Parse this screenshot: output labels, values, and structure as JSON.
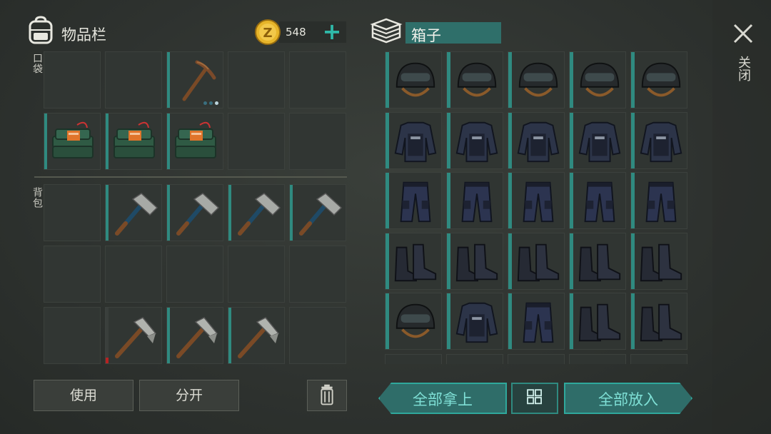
{
  "header": {
    "inventory_title": "物品栏",
    "coin_count": "548",
    "plus_symbol": "+",
    "box_title": "箱子",
    "close_label": "关闭"
  },
  "inventory": {
    "pocket_label": "口袋",
    "backpack_label": "背包",
    "pocket_rows": [
      [
        "empty",
        "empty",
        "pickaxe",
        "empty",
        "empty"
      ],
      [
        "c4-explosive",
        "c4-explosive",
        "c4-explosive",
        "empty",
        "empty"
      ]
    ],
    "backpack_rows": [
      [
        "empty",
        "hammer",
        "hammer",
        "hammer",
        "hammer"
      ],
      [
        "empty",
        "empty",
        "empty",
        "empty",
        "empty"
      ],
      [
        "empty",
        "pickaxe-hammer",
        "pickaxe-hammer",
        "pickaxe-hammer",
        "empty"
      ]
    ],
    "pickaxe_durability_dots": 3,
    "pickaxe_active_dot": 3
  },
  "box": {
    "rows": [
      [
        "helmet",
        "helmet",
        "helmet",
        "helmet",
        "helmet"
      ],
      [
        "vest",
        "vest",
        "vest",
        "vest",
        "vest"
      ],
      [
        "pants",
        "pants",
        "pants",
        "pants",
        "pants"
      ],
      [
        "boots",
        "boots",
        "boots",
        "boots",
        "boots"
      ],
      [
        "helmet",
        "vest",
        "pants",
        "boots",
        "boots"
      ]
    ]
  },
  "buttons": {
    "use": "使用",
    "split": "分开",
    "take_all": "全部拿上",
    "put_all": "全部放入"
  },
  "colors": {
    "accent": "#2fa89c",
    "slot_bg": "#313633",
    "coin": "#e7b52a"
  }
}
